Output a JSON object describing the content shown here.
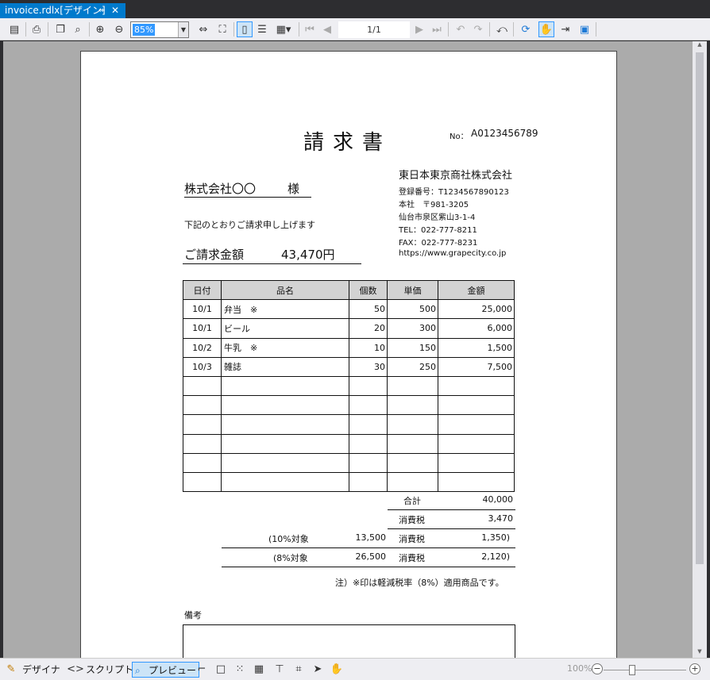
{
  "tab": {
    "title": "invoice.rdlx[デザイン]",
    "pin": "⇷",
    "close": "✕"
  },
  "toolbar": {
    "zoom": "85%",
    "page": "1/1"
  },
  "invoice": {
    "title": "請求書",
    "doc_no_label": "No：",
    "doc_no": "A0123456789",
    "customer": "株式会社〇〇",
    "honorific": "様",
    "company": {
      "name": "東日本東京商社株式会社",
      "reg": "登録番号：T1234567890123",
      "hq": "本社　〒981-3205",
      "address": "仙台市泉区紫山3-1-4",
      "tel": "TEL：022-777-8211",
      "fax": "FAX：022-777-8231",
      "url": "https://www.grapecity.co.jp"
    },
    "intro": "下記のとおりご請求申し上げます",
    "amount_label": "ご請求金額",
    "amount": "43,470円",
    "headers": [
      "日付",
      "品名",
      "個数",
      "単価",
      "金額"
    ],
    "rows": [
      [
        "10/1",
        "弁当　※",
        "50",
        "500",
        "25,000"
      ],
      [
        "10/1",
        "ビール",
        "20",
        "300",
        "6,000"
      ],
      [
        "10/2",
        "牛乳　※",
        "10",
        "150",
        "1,500"
      ],
      [
        "10/3",
        "雑誌",
        "30",
        "250",
        "7,500"
      ],
      [
        "",
        "",
        "",
        "",
        ""
      ],
      [
        "",
        "",
        "",
        "",
        ""
      ],
      [
        "",
        "",
        "",
        "",
        ""
      ],
      [
        "",
        "",
        "",
        "",
        ""
      ],
      [
        "",
        "",
        "",
        "",
        ""
      ],
      [
        "",
        "",
        "",
        "",
        ""
      ]
    ],
    "summary": {
      "subtotal_label": "合計",
      "subtotal": "40,000",
      "tax_label": "消費税",
      "tax": "3,470",
      "r10_label": "(10%対象",
      "r10_base": "13,500",
      "r10_tax_label": "消費税",
      "r10_tax": "1,350)",
      "r8_label": "(8%対象",
      "r8_base": "26,500",
      "r8_tax_label": "消費税",
      "r8_tax": "2,120)"
    },
    "note": "注）※印は軽減税率（8%）適用商品です。",
    "remarks_label": "備考"
  },
  "statusbar": {
    "design": "デザイナ",
    "script": "スクリプト",
    "preview": "プレビュー",
    "zoom": "100%"
  }
}
